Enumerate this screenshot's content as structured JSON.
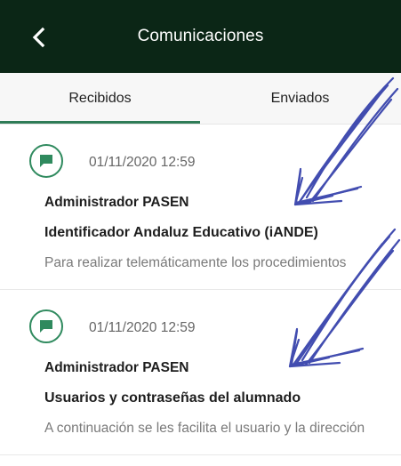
{
  "appbar": {
    "title": "Comunicaciones",
    "back_icon": "chevron-left-icon",
    "background": "#0b2616"
  },
  "tabs": [
    {
      "label": "Recibidos",
      "selected": true
    },
    {
      "label": "Enviados",
      "selected": false
    }
  ],
  "accent": "#2f7c57",
  "messages": [
    {
      "icon": "chat-bubble-icon",
      "date": "01/11/2020 12:59",
      "sender": "Administrador PASEN",
      "subject": "Identificador Andaluz Educativo (iANDE)",
      "preview": "Para realizar telemáticamente los procedimientos"
    },
    {
      "icon": "chat-bubble-icon",
      "date": "01/11/2020 12:59",
      "sender": "Administrador PASEN",
      "subject": "Usuarios y contraseñas del alumnado",
      "preview": "A continuación se les facilita el usuario y la dirección"
    }
  ],
  "annotation": {
    "type": "hand-drawn arrows",
    "color": "#2e3aa8",
    "count": 2
  }
}
